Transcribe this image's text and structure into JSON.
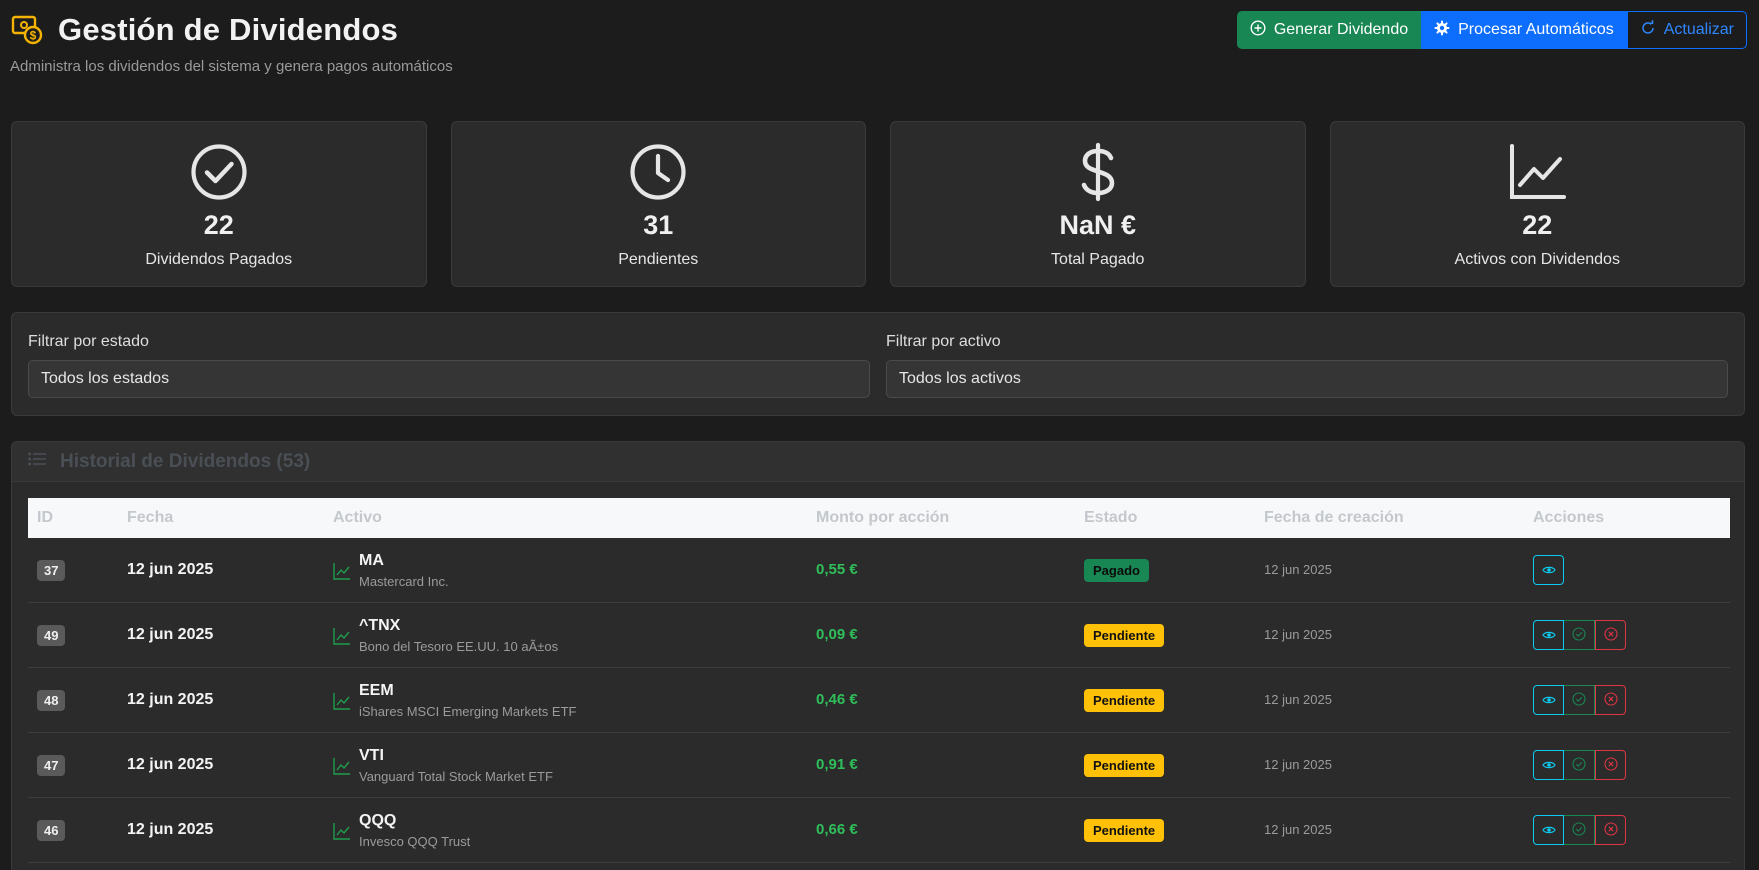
{
  "header": {
    "title": "Gestión de Dividendos",
    "subtitle": "Administra los dividendos del sistema y genera pagos automáticos",
    "icon": "cash-coin-icon",
    "buttons": {
      "generate": "Generar Dividendo",
      "process": "Procesar Automáticos",
      "refresh": "Actualizar"
    }
  },
  "stats": [
    {
      "icon": "check-circle-icon",
      "value": "22",
      "label": "Dividendos Pagados"
    },
    {
      "icon": "clock-icon",
      "value": "31",
      "label": "Pendientes"
    },
    {
      "icon": "dollar-icon",
      "value": "NaN €",
      "label": "Total Pagado"
    },
    {
      "icon": "graph-up-icon",
      "value": "22",
      "label": "Activos con Dividendos"
    }
  ],
  "filters": {
    "estado": {
      "label": "Filtrar por estado",
      "selected": "Todos los estados"
    },
    "activo": {
      "label": "Filtrar por activo",
      "selected": "Todos los activos"
    }
  },
  "history": {
    "title": "Historial de Dividendos (53)",
    "columns": [
      "ID",
      "Fecha",
      "Activo",
      "Monto por acción",
      "Estado",
      "Fecha de creación",
      "Acciones"
    ],
    "rows": [
      {
        "id": "37",
        "fecha": "12 jun 2025",
        "ticker": "MA",
        "name": "Mastercard Inc.",
        "monto": "0,55 €",
        "estado": "Pagado",
        "creacion": "12 jun 2025"
      },
      {
        "id": "49",
        "fecha": "12 jun 2025",
        "ticker": "^TNX",
        "name": "Bono del Tesoro EE.UU. 10 aÃ±os",
        "monto": "0,09 €",
        "estado": "Pendiente",
        "creacion": "12 jun 2025"
      },
      {
        "id": "48",
        "fecha": "12 jun 2025",
        "ticker": "EEM",
        "name": "iShares MSCI Emerging Markets ETF",
        "monto": "0,46 €",
        "estado": "Pendiente",
        "creacion": "12 jun 2025"
      },
      {
        "id": "47",
        "fecha": "12 jun 2025",
        "ticker": "VTI",
        "name": "Vanguard Total Stock Market ETF",
        "monto": "0,91 €",
        "estado": "Pendiente",
        "creacion": "12 jun 2025"
      },
      {
        "id": "46",
        "fecha": "12 jun 2025",
        "ticker": "QQQ",
        "name": "Invesco QQQ Trust",
        "monto": "0,66 €",
        "estado": "Pendiente",
        "creacion": "12 jun 2025"
      }
    ]
  },
  "colors": {
    "background": "#1c1c1c",
    "card": "#2b2b2b",
    "success": "#198754",
    "primary": "#0d6efd",
    "warning": "#ffc107",
    "info": "#0dcaf0",
    "danger": "#dc3545",
    "title_icon": "#f5b301"
  }
}
